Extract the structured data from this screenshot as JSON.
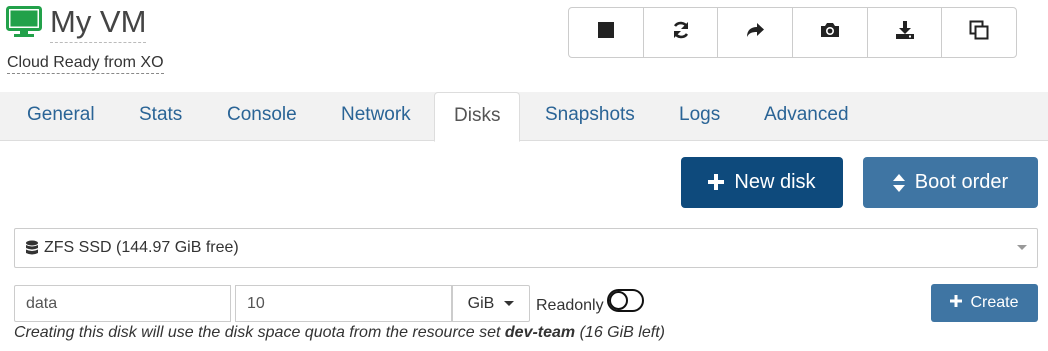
{
  "vm": {
    "name": "My VM",
    "description": "Cloud Ready from XO",
    "status_color": "#22a14a"
  },
  "toolbar": {
    "buttons": [
      {
        "icon": "stop-icon",
        "label": ""
      },
      {
        "icon": "refresh-icon",
        "label": ""
      },
      {
        "icon": "migrate-share-icon",
        "label": ""
      },
      {
        "icon": "camera-icon",
        "label": ""
      },
      {
        "icon": "download-export-icon",
        "label": ""
      },
      {
        "icon": "copy-icon",
        "label": ""
      }
    ]
  },
  "tabs": [
    {
      "label": "General",
      "active": false
    },
    {
      "label": "Stats",
      "active": false
    },
    {
      "label": "Console",
      "active": false
    },
    {
      "label": "Network",
      "active": false
    },
    {
      "label": "Disks",
      "active": true
    },
    {
      "label": "Snapshots",
      "active": false
    },
    {
      "label": "Logs",
      "active": false
    },
    {
      "label": "Advanced",
      "active": false
    }
  ],
  "actions": {
    "new_disk_label": "New disk",
    "boot_order_label": "Boot order"
  },
  "form": {
    "sr_selected": "ZFS SSD (144.97 GiB free)",
    "name_value": "data",
    "size_value": "10",
    "unit_value": "GiB",
    "readonly_label": "Readonly",
    "readonly_on": false,
    "create_label": "Create",
    "quota_prefix": "Creating this disk will use the disk space quota from the resource set ",
    "quota_set": "dev-team",
    "quota_suffix": " (16 GiB left)"
  },
  "colors": {
    "primary_dark": "#0e4a7c",
    "primary": "#3f75a3",
    "link": "#2a6496"
  }
}
